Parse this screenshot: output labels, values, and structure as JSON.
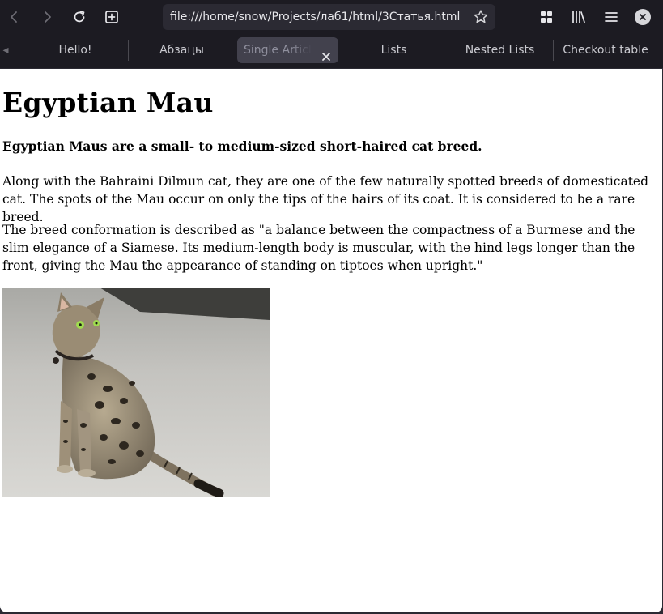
{
  "browser": {
    "url": "file:///home/snow/Projects/лаб1/html/3Статья.html",
    "tabs": [
      {
        "label": "Hello!"
      },
      {
        "label": "Абзацы"
      },
      {
        "label": "Single Article",
        "active": true
      },
      {
        "label": "Lists"
      },
      {
        "label": "Nested Lists"
      },
      {
        "label": "Checkout table"
      }
    ],
    "icons": {
      "back": "chevron-left-icon",
      "forward": "chevron-right-icon",
      "reload": "reload-icon",
      "new_tab": "new-tab-icon",
      "bookmark": "star-icon",
      "extensions": "grid-icon",
      "library": "library-icon",
      "menu": "hamburger-menu-icon",
      "close": "close-icon"
    },
    "colors": {
      "chrome": "#1c1b22",
      "urlbar": "#2b2a33",
      "active_tab": "#42414d"
    }
  },
  "article": {
    "title": "Egyptian Mau",
    "lead": "Egyptian Maus are a small- to medium-sized short-haired cat breed.",
    "paragraphs": [
      "Along with the Bahraini Dilmun cat, they are one of the few naturally spotted breeds of domesticated cat. The spots of the Mau occur on only the tips of the hairs of its coat. It is considered to be a rare breed.",
      "The breed conformation is described as \"a balance between the compactness of a Burmese and the slim elegance of a Siamese. Its medium-length body is muscular, with the hind legs longer than the front, giving the Mau the appearance of standing on tiptoes when upright.\""
    ],
    "image": "spotted egyptian mau cat sitting on pavement"
  }
}
